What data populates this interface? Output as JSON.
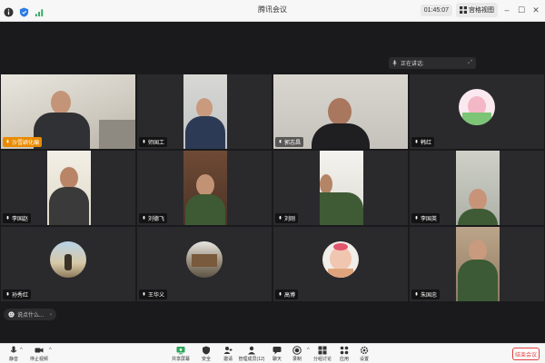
{
  "window": {
    "title": "腾讯会议"
  },
  "header": {
    "timer": "01:45:07",
    "view_label": "宫格视图"
  },
  "speaking": {
    "label": "正在讲话:"
  },
  "participants": [
    {
      "name": "沙雪颖化编"
    },
    {
      "name": "师国工"
    },
    {
      "name": "郭志昌"
    },
    {
      "name": "韩红"
    },
    {
      "name": "李国赵"
    },
    {
      "name": "刘德飞"
    },
    {
      "name": "刘刚"
    },
    {
      "name": "李国英"
    },
    {
      "name": "孙秀红"
    },
    {
      "name": "王华义"
    },
    {
      "name": "高博"
    },
    {
      "name": "朱国忠"
    }
  ],
  "chat": {
    "placeholder": "说点什么..."
  },
  "toolbar": {
    "mute": "静音",
    "stop_video": "停止视频",
    "share": "共享屏幕",
    "security": "安全",
    "record_tab": "邀请",
    "manage": "管理成员(12)",
    "chat": "聊天",
    "record": "录制",
    "apps": "分组讨论",
    "apps2": "应用",
    "settings": "设置",
    "end": "结束会议"
  },
  "colors": {
    "active_border": "#f0b400",
    "end_red": "#e04040",
    "share_green": "#2aa55a"
  }
}
